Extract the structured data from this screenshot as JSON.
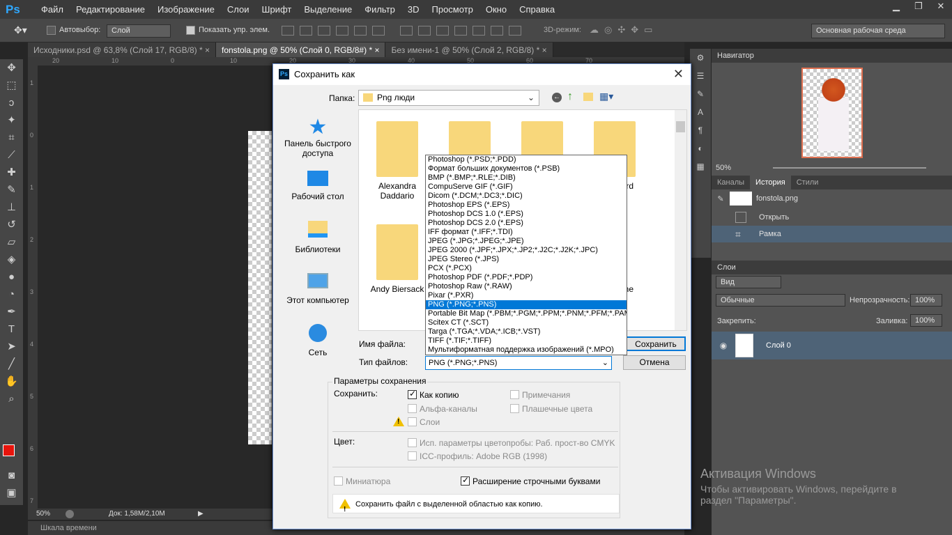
{
  "app": {
    "logo": "Ps"
  },
  "menu": [
    "Файл",
    "Редактирование",
    "Изображение",
    "Слои",
    "Шрифт",
    "Выделение",
    "Фильтр",
    "3D",
    "Просмотр",
    "Окно",
    "Справка"
  ],
  "options_bar": {
    "autoselect_label": "Автовыбор:",
    "autoselect_value": "Слой",
    "show_controls_label": "Показать упр. элем.",
    "mode3d_label": "3D-режим:",
    "workspace": "Основная рабочая среда"
  },
  "tabs": [
    {
      "label": "Исходники.psd @ 63,8% (Слой 17, RGB/8) *",
      "close": "×"
    },
    {
      "label": "fonstola.png @ 50% (Слой 0, RGB/8#) *",
      "close": "×"
    },
    {
      "label": "Без имени-1 @ 50% (Слой 2, RGB/8) *",
      "close": "×"
    }
  ],
  "ruler": {
    "top_ticks": [
      "20",
      "10",
      "0",
      "10",
      "20",
      "30",
      "40",
      "50",
      "60",
      "70"
    ],
    "left_ticks": [
      "1",
      "0",
      "1",
      "2",
      "3",
      "4",
      "5",
      "6",
      "7"
    ]
  },
  "status": {
    "zoom": "50%",
    "doc": "Док: 1,58M/2,10M"
  },
  "timeline": "Шкала времени",
  "navigator": {
    "title": "Навигатор",
    "zoom": "50%"
  },
  "history": {
    "tabs": [
      "Каналы",
      "История",
      "Стили"
    ],
    "snapshot": "fonstola.png",
    "items": [
      "Открыть",
      "Рамка"
    ]
  },
  "layers": {
    "title": "Слои",
    "filter": "Вид",
    "blend": "Обычные",
    "opacity_label": "Непрозрачность:",
    "opacity": "100%",
    "lock_label": "Закрепить:",
    "fill_label": "Заливка:",
    "fill": "100%",
    "layer_name": "Слой 0"
  },
  "activation": {
    "title": "Активация Windows",
    "line1": "Чтобы активировать Windows, перейдите в",
    "line2": "раздел \"Параметры\"."
  },
  "dialog": {
    "title": "Сохранить как",
    "folder_label": "Папка:",
    "folder": "Png люди",
    "places": [
      "Панель быстрого доступа",
      "Рабочий стол",
      "Библиотеки",
      "Этот компьютер",
      "Сеть"
    ],
    "folders": [
      "Alexandra Daddario",
      "Andy Biersack",
      "eard",
      "gne"
    ],
    "filename_label": "Имя файла:",
    "filetype_label": "Тип файлов:",
    "filetype": "PNG (*.PNG;*.PNS)",
    "save": "Сохранить",
    "cancel": "Отмена",
    "filetypes": [
      "Photoshop (*.PSD;*.PDD)",
      "Формат больших документов (*.PSB)",
      "BMP (*.BMP;*.RLE;*.DIB)",
      "CompuServe GIF (*.GIF)",
      "Dicom (*.DCM;*.DC3;*.DIC)",
      "Photoshop EPS (*.EPS)",
      "Photoshop DCS 1.0 (*.EPS)",
      "Photoshop DCS 2.0 (*.EPS)",
      "IFF формат (*.IFF;*.TDI)",
      "JPEG (*.JPG;*.JPEG;*.JPE)",
      "JPEG 2000 (*.JPF;*.JPX;*.JP2;*.J2C;*.J2K;*.JPC)",
      "JPEG Stereo (*.JPS)",
      "PCX (*.PCX)",
      "Photoshop PDF (*.PDF;*.PDP)",
      "Photoshop Raw (*.RAW)",
      "Pixar (*.PXR)",
      "PNG (*.PNG;*.PNS)",
      "Portable Bit Map (*.PBM;*.PGM;*.PPM;*.PNM;*.PFM;*.PAM)",
      "Scitex CT (*.SCT)",
      "Targa (*.TGA;*.VDA;*.ICB;*.VST)",
      "TIFF (*.TIF;*.TIFF)",
      "Мультиформатная поддержка изображений  (*.MPO)"
    ],
    "selected_type_index": 16,
    "save_options": {
      "group": "Параметры сохранения",
      "save_label": "Сохранить:",
      "as_copy": "Как копию",
      "alpha": "Альфа-каналы",
      "layers": "Слои",
      "notes": "Примечания",
      "spot": "Плашечные цвета",
      "color_label": "Цвет:",
      "proof": "Исп. параметры цветопробы:  Раб. прост-во CMYK",
      "icc": "ICC-профиль:  Adobe RGB (1998)",
      "thumbnail": "Миниатюра",
      "lowercase": "Расширение строчными буквами",
      "warning": "Сохранить файл с выделенной областью как копию."
    }
  },
  "colors": {
    "accent": "#0078d7",
    "fg_swatch": "#e8140c",
    "ps_blue": "#2fa8ff"
  }
}
